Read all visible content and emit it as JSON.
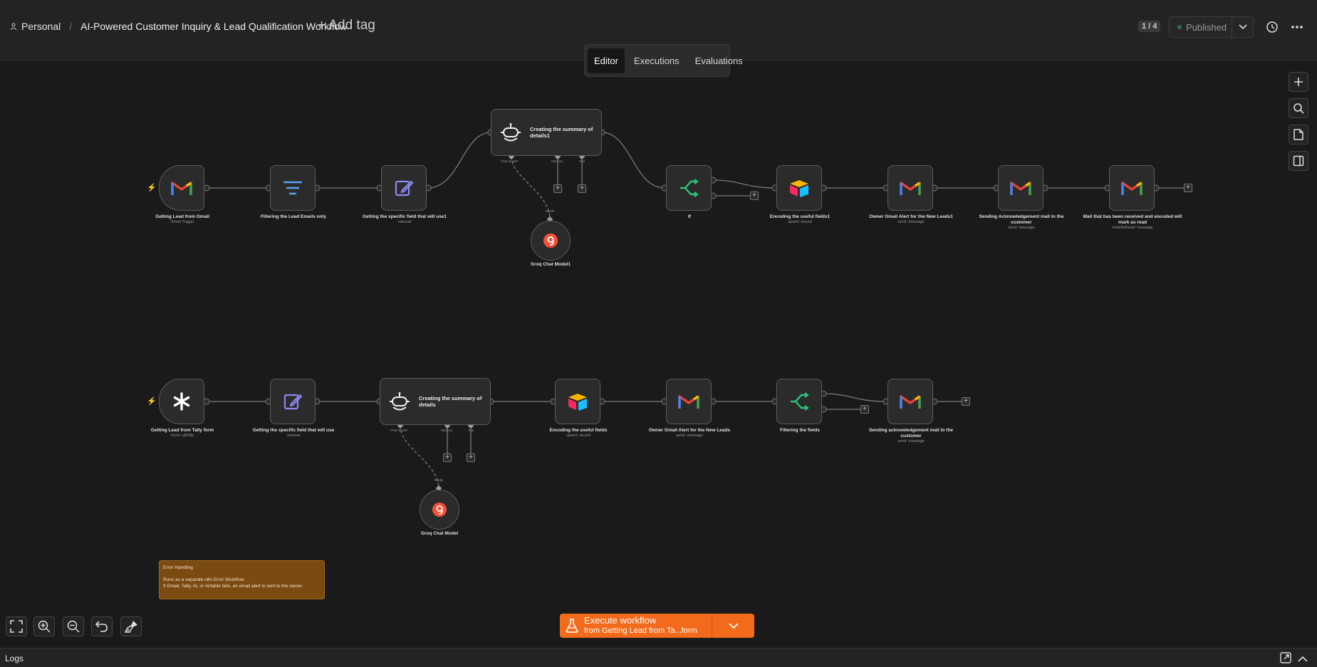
{
  "header": {
    "workspace": "Personal",
    "title": "AI-Powered Customer Inquiry & Lead Qualification Workflow",
    "add_tag": "+ Add tag",
    "counter": "1 / 4",
    "status": "Published"
  },
  "tabs": [
    "Editor",
    "Executions",
    "Evaluations"
  ],
  "row1": {
    "n1": {
      "label": "Getting Lead from Gmail",
      "sub": "Gmail Trigger"
    },
    "n2": {
      "label": "Filtering the Lead Emails only",
      "sub": ""
    },
    "n3": {
      "label": "Getting the specific field that will use1",
      "sub": "manual"
    },
    "agent": {
      "title": "Creating the summary of details1",
      "ports": [
        "Chat Model*",
        "Memory",
        "Tool"
      ]
    },
    "model": {
      "label": "Groq Chat Model1",
      "port": "Model"
    },
    "n5": {
      "label": "If",
      "sub": ""
    },
    "n6": {
      "label": "Encoding the useful fields1",
      "sub": "upsert: record"
    },
    "n7": {
      "label": "Owner Gmail Alert for the New Leads1",
      "sub": "send: message"
    },
    "n8": {
      "label": "Sending Acknowledgement mail to the customer",
      "sub": "send: message"
    },
    "n9": {
      "label": "Mail that has been received and encoded will mark as read",
      "sub": "markAsRead: message"
    }
  },
  "row2": {
    "n1": {
      "label": "Getting Lead from Tally form",
      "sub": "Form: q9D9p"
    },
    "n2": {
      "label": "Getting the specific field that will use",
      "sub": "manual"
    },
    "agent": {
      "title": "Creating the summary of details",
      "ports": [
        "Chat Model*",
        "Memory",
        "Tool"
      ]
    },
    "model": {
      "label": "Groq Chat Model",
      "port": "Model"
    },
    "n4": {
      "label": "Encoding the useful fields",
      "sub": "upsert: record"
    },
    "n5": {
      "label": "Owner Gmail Alert for the New Leads",
      "sub": "send: message"
    },
    "n6": {
      "label": "Filtering the fields",
      "sub": ""
    },
    "n7": {
      "label": "Sending acknowledgement mail to the customer",
      "sub": "send: message"
    }
  },
  "sticky": {
    "title": "Error Handling",
    "line1": "Runs as a separate n8n Error Workflow.",
    "line2": "If Gmail, Tally, AI, or Airtable fails, an email alert is sent to the owner."
  },
  "execute": {
    "label": "Execute workflow",
    "sub": "from Getting Lead from Ta...form"
  },
  "footer": {
    "logs": "Logs"
  },
  "colors": {
    "accent": "#f26a1b",
    "sticky": "#7a4a10",
    "canvas": "#1a1a1a"
  }
}
